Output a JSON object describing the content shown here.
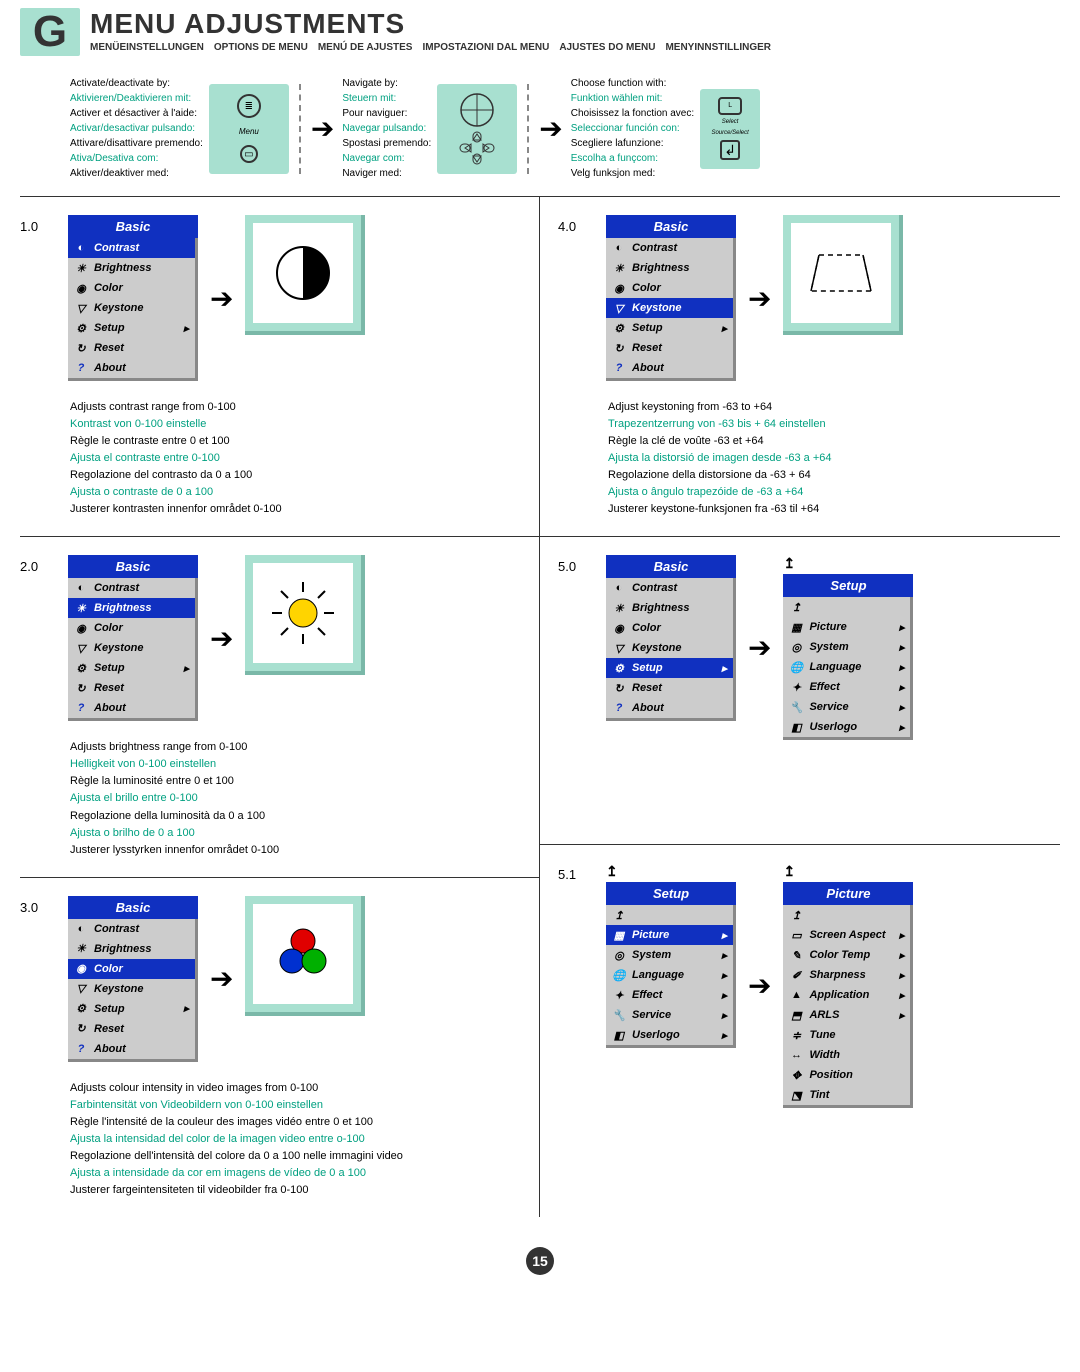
{
  "header": {
    "badge": "G",
    "title": "MENU ADJUSTMENTS",
    "subtitles": [
      "MENÜEINSTELLUNGEN",
      "OPTIONS DE MENU",
      "MENÚ DE AJUSTES",
      "IMPOSTAZIONI DAL MENU",
      "AJUSTES DO MENU",
      "MENYINNSTILLINGER"
    ]
  },
  "intro": {
    "activate": {
      "en": "Activate/deactivate by:",
      "de": "Aktivieren/Deaktivieren mit:",
      "fr": "Activer et désactiver à l'aide:",
      "es": "Activar/desactivar pulsando:",
      "it": "Attivare/disattivare premendo:",
      "pt": "Ativa/Desativa com:",
      "no": "Aktiver/deaktiver med:"
    },
    "navigate": {
      "en": "Navigate by:",
      "de": "Steuern mit:",
      "fr": "Pour naviguer:",
      "es": "Navegar pulsando:",
      "it": "Spostasi premendo:",
      "pt": "Navegar com:",
      "no": "Naviger med:"
    },
    "choose": {
      "en": "Choose function with:",
      "de": "Funktion wählen mit:",
      "fr": "Choisissez la fonction avec:",
      "es": "Seleccionar función con:",
      "it": "Scegliere lafunzione:",
      "pt": "Escolha a funçcom:",
      "no": "Velg funksjon med:"
    },
    "menu_label": "Menu",
    "select_label": "Select",
    "source_label": "Source/Select",
    "l_label": "L"
  },
  "menu": {
    "basic_title": "Basic",
    "setup_title": "Setup",
    "picture_title": "Picture",
    "contrast": "Contrast",
    "brightness": "Brightness",
    "color": "Color",
    "keystone": "Keystone",
    "setup": "Setup",
    "reset": "Reset",
    "about": "About",
    "picture": "Picture",
    "system": "System",
    "language": "Language",
    "effect": "Effect",
    "service": "Service",
    "userlogo": "Userlogo",
    "screen_aspect": "Screen Aspect",
    "color_temp": "Color Temp",
    "sharpness": "Sharpness",
    "application": "Application",
    "arls": "ARLS",
    "tune": "Tune",
    "width": "Width",
    "position": "Position",
    "tint": "Tint",
    "up": "↥"
  },
  "sections": {
    "s1": {
      "num": "1.0",
      "d": {
        "en": "Adjusts contrast range from 0-100",
        "de": "Kontrast von 0-100 einstelle",
        "fr": "Règle le contraste entre 0 et 100",
        "es": "Ajusta el contraste entre 0-100",
        "it": "Regolazione del contrasto da 0 a 100",
        "pt": "Ajusta o contraste de 0 a 100",
        "no": "Justerer kontrasten innenfor området 0-100"
      }
    },
    "s2": {
      "num": "2.0",
      "d": {
        "en": "Adjusts brightness range from 0-100",
        "de": "Helligkeit von 0-100 einstellen",
        "fr": "Règle la luminosité entre 0 et 100",
        "es": "Ajusta el brillo entre 0-100",
        "it": "Regolazione della luminosità da 0 a 100",
        "pt": "Ajusta o brilho de 0 a 100",
        "no": "Justerer lysstyrken innenfor området 0-100"
      }
    },
    "s3": {
      "num": "3.0",
      "d": {
        "en": "Adjusts colour intensity in video images from 0-100",
        "de": "Farbintensität von Videobildern von 0-100 einstellen",
        "fr": "Règle l'intensité de la couleur des images vidéo entre 0 et 100",
        "es": "Ajusta la intensidad del color de la imagen video entre o-100",
        "it": "Regolazione dell'intensità del colore da 0 a 100 nelle immagini video",
        "pt": "Ajusta a intensidade da cor em imagens de vídeo de 0 a 100",
        "no": "Justerer fargeintensiteten til videobilder fra 0-100"
      }
    },
    "s4": {
      "num": "4.0",
      "d": {
        "en": "Adjust keystoning from -63 to +64",
        "de": "Trapezentzerrung von -63 bis + 64 einstellen",
        "fr": "Règle la clé de voûte -63 et +64",
        "es": "Ajusta la distorsió de imagen desde -63 a +64",
        "it": "Regolazione della distorsione da -63 + 64",
        "pt": "Ajusta o ângulo trapezóide de -63 a +64",
        "no": "Justerer keystone-funksjonen fra -63 til +64"
      }
    },
    "s5": {
      "num": "5.0"
    },
    "s51": {
      "num": "5.1"
    }
  },
  "pagenum": "15"
}
